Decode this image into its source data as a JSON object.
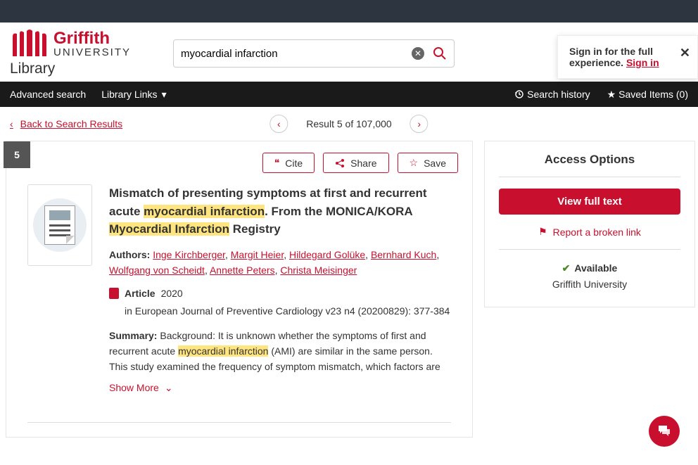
{
  "brand": {
    "name": "Griffith",
    "sub": "UNIVERSITY",
    "library": "Library"
  },
  "search": {
    "query": "myocardial infarction"
  },
  "signin": {
    "text": "Sign in for the full experience.",
    "link": "Sign in"
  },
  "nav": {
    "advanced": "Advanced search",
    "links": "Library Links",
    "history": "Search history",
    "saved": "Saved Items (0)"
  },
  "result": {
    "back": "Back to Search Results",
    "position": "Result 5 of 107,000",
    "index": "5"
  },
  "actions": {
    "cite": "Cite",
    "share": "Share",
    "save": "Save"
  },
  "article": {
    "title_pre": "Mismatch of presenting symptoms at first and recurrent acute ",
    "hl1": "myocardial infarction",
    "title_mid": ". From the MONICA/KORA ",
    "hl2": "Myocardial Infarction",
    "title_post": " Registry",
    "authors_label": "Authors:",
    "authors": [
      "Inge Kirchberger",
      "Margit Heier",
      "Hildegard Golüke",
      "Bernhard Kuch",
      "Wolfgang von Scheidt",
      "Annette Peters",
      "Christa Meisinger"
    ],
    "type": "Article",
    "year": "2020",
    "pub": "in European Journal of Preventive Cardiology  v23 n4 (20200829): 377-384",
    "summary_label": "Summary:",
    "summary_pre": "Background: It is unknown whether the symptoms of first and recurrent acute ",
    "summary_hl": "myocardial infarction",
    "summary_post": " (AMI) are similar in the same person. This study examined the frequency of symptom mismatch, which factors are",
    "showmore": "Show More"
  },
  "access": {
    "title": "Access Options",
    "view": "View full text",
    "report": "Report a broken link",
    "available": "Available",
    "inst": "Griffith University"
  }
}
